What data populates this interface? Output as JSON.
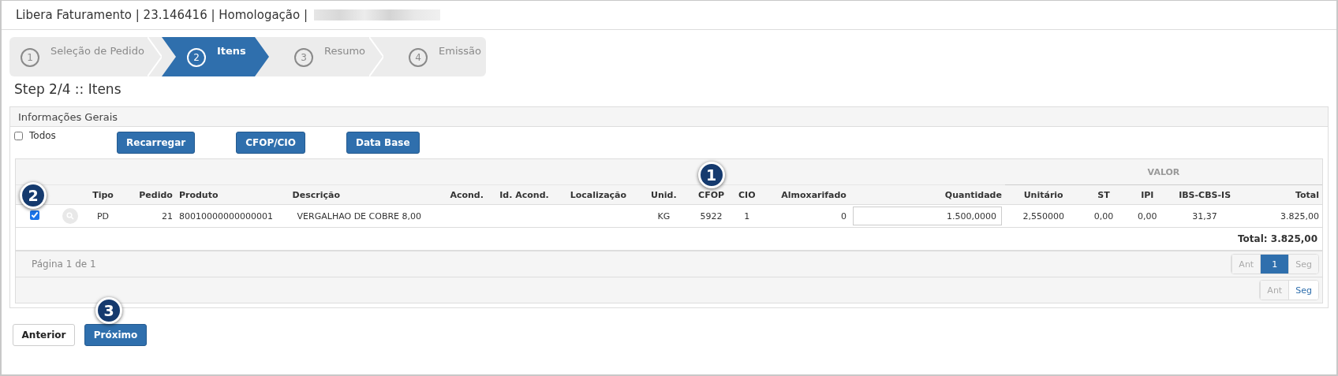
{
  "window": {
    "title": "Libera Faturamento | 23.146416 | Homologação |"
  },
  "stepper": [
    {
      "number": "1",
      "label": "Seleção de Pedido",
      "selected": false
    },
    {
      "number": "2",
      "label": "Itens",
      "selected": true
    },
    {
      "number": "3",
      "label": "Resumo",
      "selected": false
    },
    {
      "number": "4",
      "label": "Emissão",
      "selected": false
    }
  ],
  "step_heading": "Step 2/4 :: Itens",
  "panel": {
    "title": "Informações Gerais",
    "select_all": {
      "label": "Todos",
      "checked": false
    },
    "buttons": [
      "Recarregar",
      "CFOP/CIO",
      "Data Base"
    ],
    "table": {
      "columns": [
        {
          "label": "Tipo"
        },
        {
          "label": "Pedido"
        },
        {
          "label": "Produto"
        },
        {
          "label": "Descrição"
        },
        {
          "label": "Acond."
        },
        {
          "label": "Id. Acond."
        },
        {
          "label": "Localização"
        },
        {
          "label": "Unid."
        },
        {
          "label": "CFOP",
          "callout": "1"
        },
        {
          "label": "CIO"
        },
        {
          "label": "Almoxarifado"
        },
        {
          "label": "Quantidade"
        }
      ],
      "value_group": {
        "label": "VALOR",
        "columns": [
          {
            "label": "Unitário"
          },
          {
            "label": "ST"
          },
          {
            "label": "IPI"
          },
          {
            "label": "IBS-CBS-IS"
          },
          {
            "label": "Total"
          }
        ]
      },
      "rows": [
        {
          "checked": true,
          "callout": "2",
          "cells": [
            {
              "kind": "text",
              "text": "PD"
            },
            {
              "kind": "text",
              "text": "21"
            },
            {
              "kind": "text",
              "text": "80010000000000001"
            },
            {
              "kind": "text",
              "text": "VERGALHAO DE COBRE 8,00"
            },
            {
              "kind": "empty"
            },
            {
              "kind": "empty"
            },
            {
              "kind": "empty"
            },
            {
              "kind": "text",
              "text": "KG"
            },
            {
              "kind": "text",
              "text": "5922"
            },
            {
              "kind": "text",
              "text": "1"
            },
            {
              "kind": "text",
              "text": "0"
            },
            {
              "kind": "input",
              "value": "1.500,0000"
            },
            {
              "kind": "text",
              "text": "2,550000"
            },
            {
              "kind": "text",
              "text": "0,00"
            },
            {
              "kind": "text",
              "text": "0,00"
            },
            {
              "kind": "text",
              "text": "31,37"
            },
            {
              "kind": "text",
              "text": "3.825,00"
            }
          ]
        }
      ],
      "footer_total": "Total: 3.825,00",
      "page_info": "Página 1 de 1",
      "pager": [
        {
          "label": "Ant",
          "selected": false,
          "disabled": true
        },
        {
          "label": "1",
          "selected": true,
          "disabled": false
        },
        {
          "label": "Seg",
          "selected": false,
          "disabled": true
        }
      ],
      "pager_2": [
        {
          "label": "Ant",
          "selected": false,
          "disabled": true
        },
        {
          "label": "Seg",
          "selected": false,
          "disabled": false
        }
      ]
    }
  },
  "nav_buttons": [
    {
      "label": "Anterior",
      "kind": "default"
    },
    {
      "label": "Próximo",
      "kind": "primary",
      "callout": "3"
    }
  ]
}
